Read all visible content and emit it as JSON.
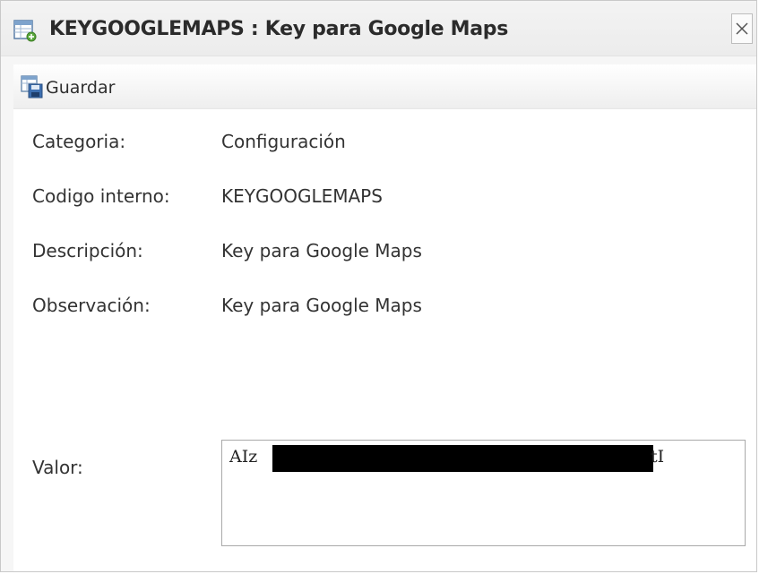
{
  "window": {
    "title": "KEYGOOGLEMAPS : Key para Google Maps",
    "title_icon": "table-form-icon",
    "close_icon": "close-icon"
  },
  "toolbar": {
    "save_label": "Guardar",
    "save_icon": "floppy-table-icon"
  },
  "fields": [
    {
      "label": "Categoria:",
      "value": "Configuración"
    },
    {
      "label": "Codigo interno:",
      "value": "KEYGOOGLEMAPS"
    },
    {
      "label": "Descripción:",
      "value": "Key para Google Maps"
    },
    {
      "label": "Observación:",
      "value": "Key para Google Maps"
    }
  ],
  "valor": {
    "label": "Valor:",
    "visible_prefix": "AIz",
    "visible_suffix": "tI",
    "redacted": true
  }
}
